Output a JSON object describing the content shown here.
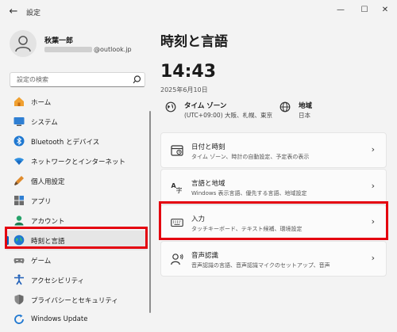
{
  "window": {
    "title": "設定",
    "back_glyph": "←",
    "min_glyph": "—",
    "max_glyph": "☐",
    "close_glyph": "✕"
  },
  "profile": {
    "name": "秋葉一郎",
    "email_suffix": "@outlook.jp"
  },
  "search": {
    "placeholder": "設定の検索"
  },
  "nav": {
    "items": [
      {
        "label": "ホーム",
        "icon": "home-icon"
      },
      {
        "label": "システム",
        "icon": "system-icon"
      },
      {
        "label": "Bluetooth とデバイス",
        "icon": "bluetooth-icon"
      },
      {
        "label": "ネットワークとインターネット",
        "icon": "network-icon"
      },
      {
        "label": "個人用設定",
        "icon": "personalization-icon"
      },
      {
        "label": "アプリ",
        "icon": "apps-icon"
      },
      {
        "label": "アカウント",
        "icon": "account-icon"
      },
      {
        "label": "時刻と言語",
        "icon": "time-language-icon",
        "selected": true
      },
      {
        "label": "ゲーム",
        "icon": "gaming-icon"
      },
      {
        "label": "アクセシビリティ",
        "icon": "accessibility-icon"
      },
      {
        "label": "プライバシーとセキュリティ",
        "icon": "privacy-icon"
      },
      {
        "label": "Windows Update",
        "icon": "windows-update-icon"
      }
    ]
  },
  "main": {
    "title": "時刻と言語",
    "time": "14:43",
    "date": "2025年6月10日",
    "timezone": {
      "title": "タイム ゾーン",
      "value": "(UTC+09:00) 大阪、札幌、東京"
    },
    "region": {
      "title": "地域",
      "value": "日本"
    },
    "cards": [
      {
        "title": "日付と時刻",
        "subtitle": "タイム ゾーン、時計の自動設定、予定表の表示",
        "icon": "clock-icon"
      },
      {
        "title": "言語と地域",
        "subtitle": "Windows 表示言語、優先する言語、地域設定",
        "icon": "language-icon"
      },
      {
        "title": "入力",
        "subtitle": "タッチキーボード、テキスト候補、環境設定",
        "icon": "keyboard-icon"
      },
      {
        "title": "音声認識",
        "subtitle": "音声認識の言語、音声認識マイクのセットアップ、音声",
        "icon": "microphone-icon"
      }
    ],
    "chevron_glyph": "›"
  },
  "colors": {
    "accent": "#0067c0",
    "highlight": "#e4000f"
  }
}
